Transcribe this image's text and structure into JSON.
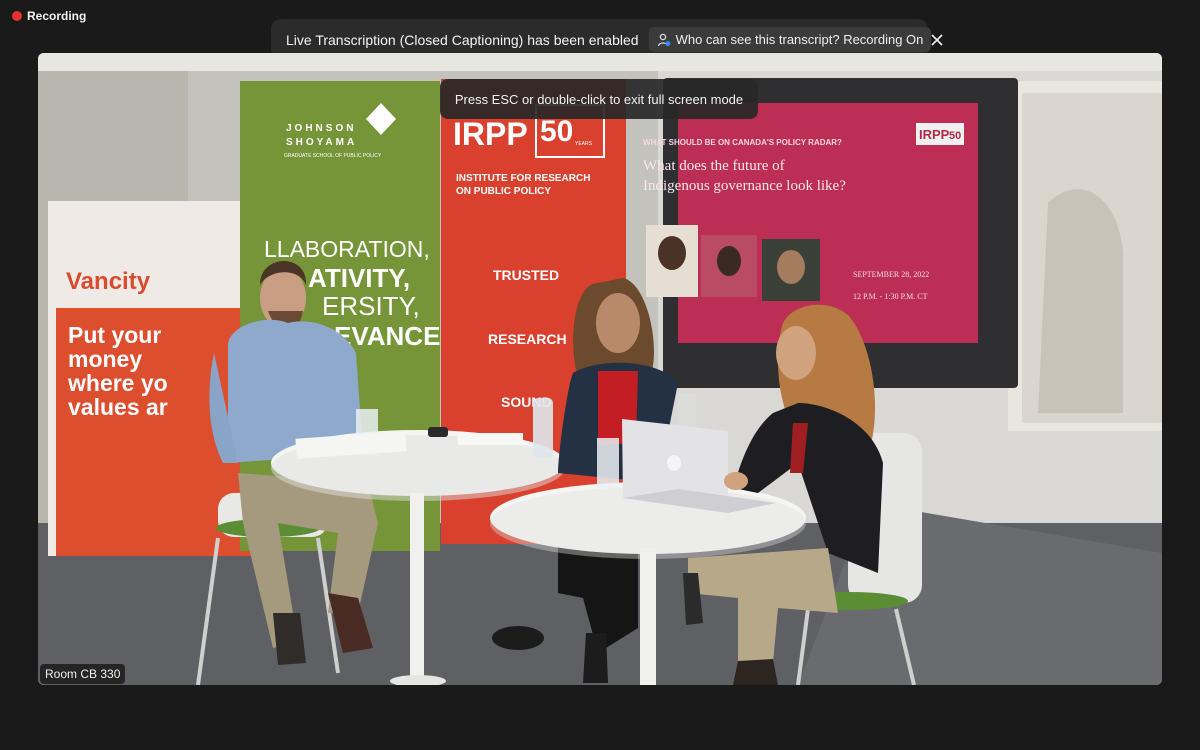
{
  "recording": {
    "label": "Recording",
    "color": "#e8322b"
  },
  "caption_banner": {
    "message": "Live Transcription (Closed Captioning) has been enabled",
    "who_button": "Who can see this transcript? Recording On",
    "icons": {
      "who": "person-icon",
      "close": "close-icon"
    }
  },
  "fullscreen_toast": "Press ESC or double-click to exit full screen mode",
  "room_label": "Room CB 330",
  "scene": {
    "banner_vancity": {
      "brand": "Vancity",
      "slogan": [
        "Put your",
        "money",
        "where yo",
        "values ar"
      ]
    },
    "banner_jsgs": {
      "name": [
        "JOHNSON",
        "SHOYAMA"
      ],
      "sub": "GRADUATE SCHOOL OF PUBLIC POLICY",
      "words": [
        "LLABORATION,",
        "ATIVITY,",
        "ERSITY,",
        "EVANCE"
      ]
    },
    "banner_irpp": {
      "logo": "IRPP",
      "years": "50",
      "years_sub": "YEARS",
      "line1": "INSTITUTE FOR RESEARCH",
      "line2": "ON PUBLIC POLICY",
      "words": [
        "TRUSTED",
        "RESEARCH",
        "SOUND"
      ]
    },
    "screen": {
      "kicker": "WHAT SHOULD BE ON CANADA'S POLICY RADAR?",
      "title_1": "What does the future of",
      "title_2": "Indigenous governance look like?",
      "logo": "IRPP",
      "logo_num": "50",
      "date": "SEPTEMBER 28, 2022",
      "time": "12 P.M. - 1:30 P.M. CT"
    }
  }
}
